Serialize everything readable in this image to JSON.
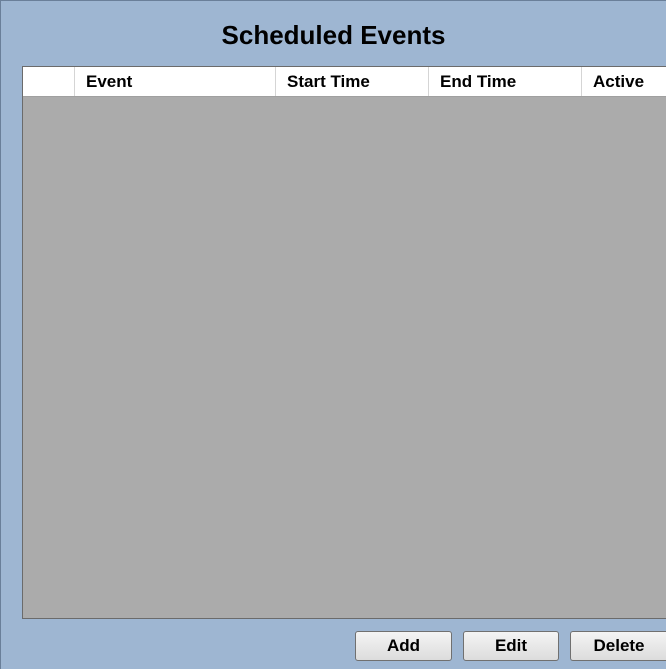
{
  "panel": {
    "title": "Scheduled Events"
  },
  "grid": {
    "columns": [
      {
        "id": "selector",
        "label": ""
      },
      {
        "id": "event",
        "label": "Event"
      },
      {
        "id": "start_time",
        "label": "Start Time"
      },
      {
        "id": "end_time",
        "label": "End Time"
      },
      {
        "id": "active",
        "label": "Active"
      }
    ],
    "rows": []
  },
  "buttons": {
    "add": "Add",
    "edit": "Edit",
    "delete": "Delete"
  },
  "colors": {
    "panel_background": "#9eb6d2",
    "grid_background": "#ababab",
    "header_background": "#ffffff"
  }
}
